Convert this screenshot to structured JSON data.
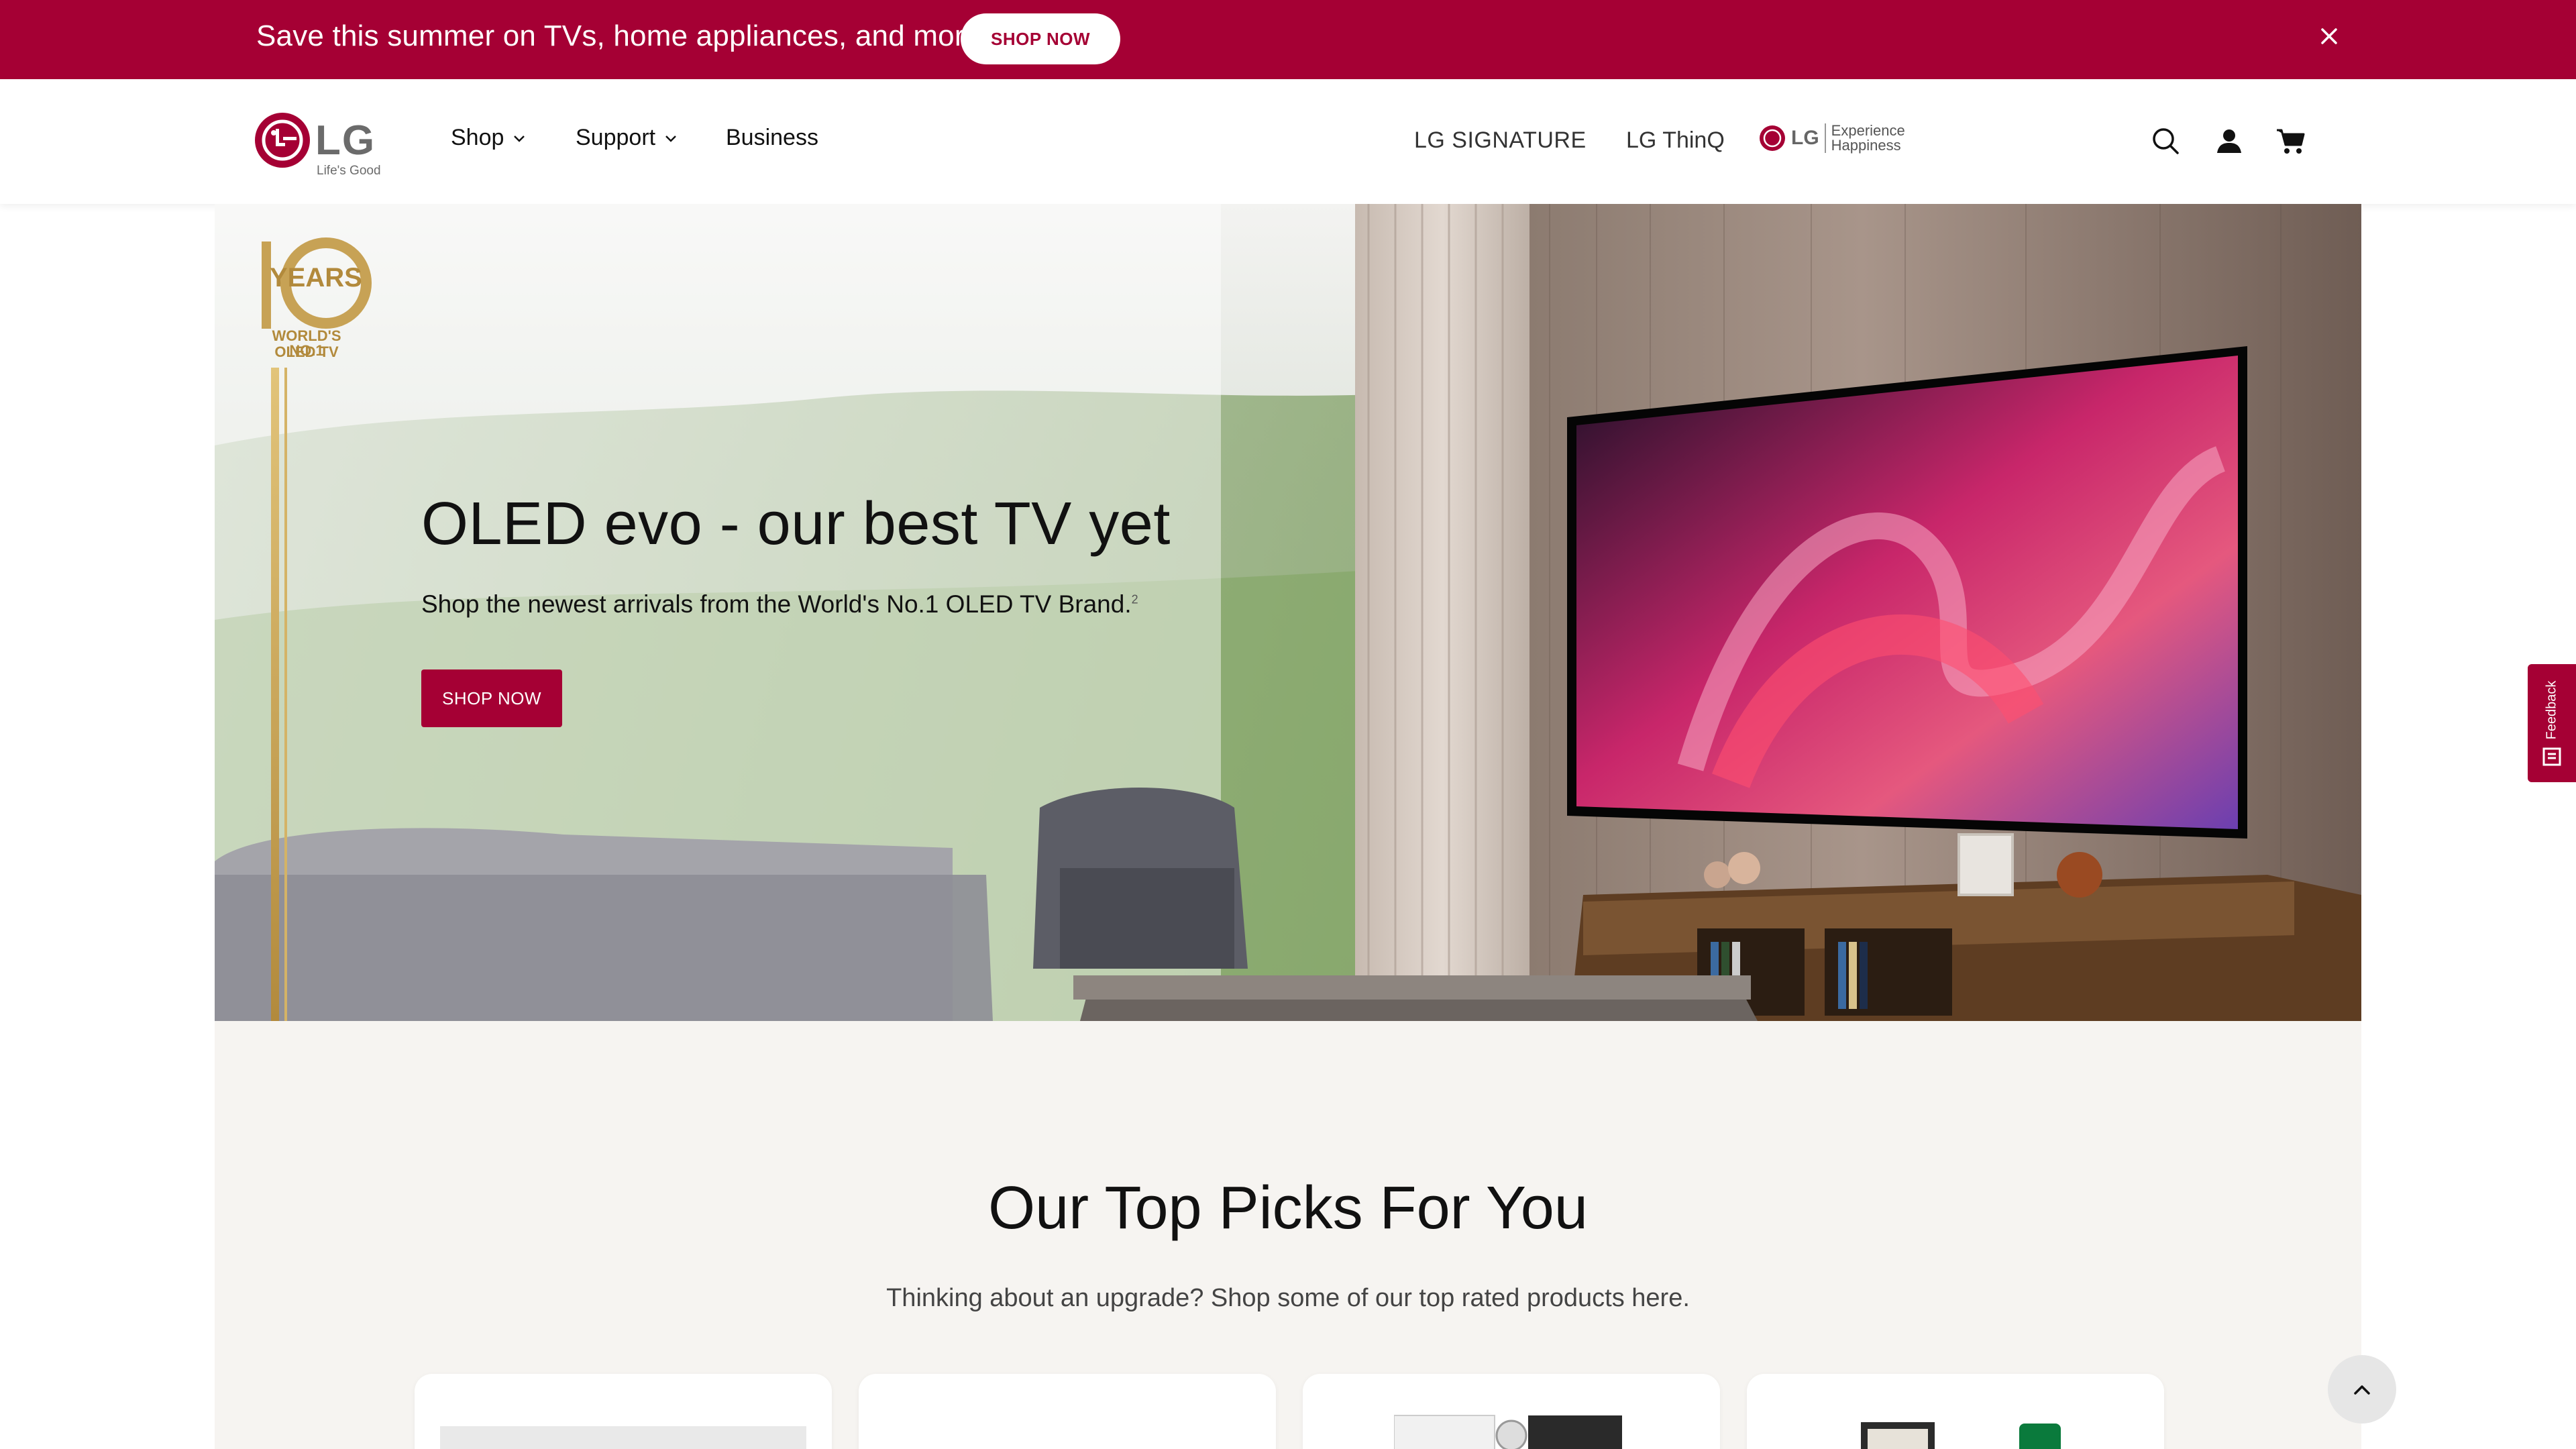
{
  "promo": {
    "text": "Save this summer on TVs, home appliances, and more",
    "button": "SHOP NOW",
    "close_icon": "close-icon"
  },
  "header": {
    "logo_text": "LG",
    "logo_tagline": "Life's Good",
    "nav": [
      {
        "label": "Shop",
        "has_dropdown": true
      },
      {
        "label": "Support",
        "has_dropdown": true
      },
      {
        "label": "Business",
        "has_dropdown": false
      }
    ],
    "brands": {
      "signature": "LG SIGNATURE",
      "thinq": "LG ThinQ",
      "eh_logo": "LG",
      "eh_line1": "Experience",
      "eh_line2": "Happiness"
    },
    "icons": [
      "search-icon",
      "account-icon",
      "cart-icon"
    ]
  },
  "hero": {
    "badge_number": "10",
    "badge_years": "YEARS",
    "badge_line1": "WORLD'S NO.1",
    "badge_line2": "OLED TV",
    "title": "OLED evo - our best TV yet",
    "subtitle": "Shop the newest arrivals from the World's No.1 OLED TV Brand.",
    "footnote": "2",
    "button": "SHOP NOW",
    "slides_total": 2,
    "active_slide": 2
  },
  "picks": {
    "title": "Our Top Picks For You",
    "subtitle": "Thinking about an upgrade? Shop some of our top rated products here."
  },
  "floating": {
    "feedback_label": "Feedback"
  },
  "colors": {
    "brand": "#a50034",
    "hero_bg": "#f6f4f1"
  }
}
